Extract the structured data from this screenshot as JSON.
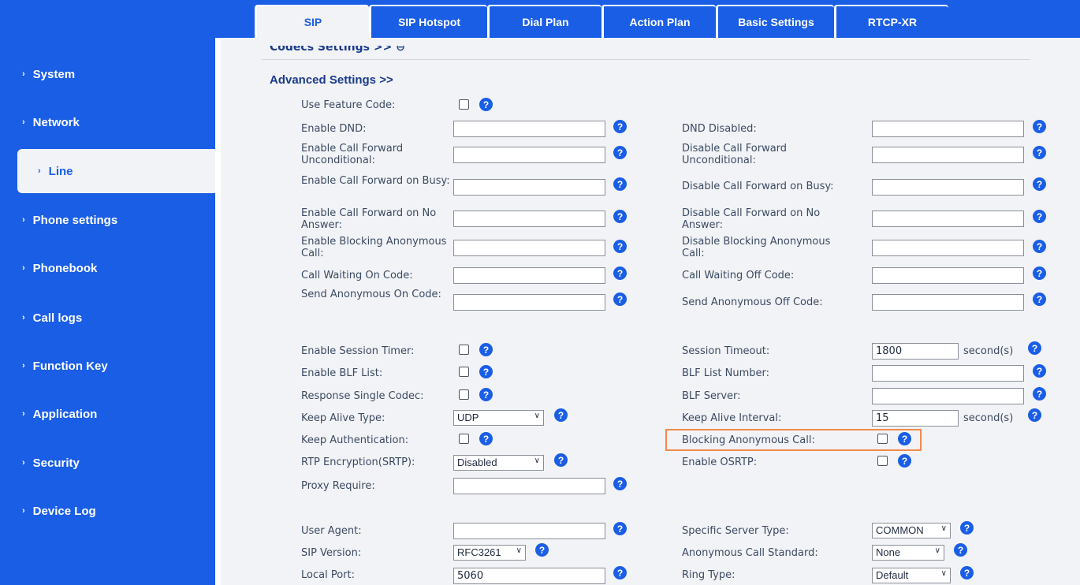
{
  "tabs": [
    "SIP",
    "SIP Hotspot",
    "Dial Plan",
    "Action Plan",
    "Basic Settings",
    "RTCP-XR"
  ],
  "sidebar": [
    "System",
    "Network",
    "Line",
    "Phone settings",
    "Phonebook",
    "Call logs",
    "Function Key",
    "Application",
    "Security",
    "Device Log"
  ],
  "nav_chevron": "›",
  "codecs_cut": "Codecs Settings >> ⊖",
  "advanced_title": "Advanced Settings >>",
  "help_glyph": "?",
  "select_arrow": "∨",
  "fields": {
    "use_feature_code": "Use Feature Code:",
    "enable_dnd": "Enable DND:",
    "dnd_disabled": "DND Disabled:",
    "ecf_uncond": "Enable Call Forward Unconditional:",
    "dcf_uncond": "Disable Call Forward Unconditional:",
    "ecf_busy": "Enable Call Forward on Busy:",
    "dcf_busy": "Disable Call Forward on Busy:",
    "ecf_noans": "Enable Call Forward on No Answer:",
    "dcf_noans": "Disable Call Forward on No Answer:",
    "enable_block": "Enable Blocking Anonymous Call:",
    "disable_block": "Disable Blocking Anonymous Call:",
    "cw_on": "Call Waiting On Code:",
    "cw_off": "Call Waiting Off Code:",
    "send_anon_on": "Send Anonymous On Code:",
    "send_anon_off": "Send Anonymous Off Code:",
    "session_timer": "Enable Session Timer:",
    "session_timeout": "Session Timeout:",
    "session_timeout_value": "1800",
    "seconds": "second(s)",
    "blf_list": "Enable BLF List:",
    "blf_list_number": "BLF List Number:",
    "resp_single_codec": "Response Single Codec:",
    "blf_server": "BLF Server:",
    "keep_alive_type": "Keep Alive Type:",
    "keep_alive_type_value": "UDP",
    "keep_alive_interval": "Keep Alive Interval:",
    "keep_alive_interval_value": "15",
    "keep_auth": "Keep Authentication:",
    "blocking_anon": "Blocking Anonymous Call:",
    "rtp_enc": "RTP Encryption(SRTP):",
    "rtp_enc_value": "Disabled",
    "enable_osrtp": "Enable OSRTP:",
    "proxy_require": "Proxy Require:",
    "user_agent": "User Agent:",
    "specific_server": "Specific Server Type:",
    "specific_server_value": "COMMON",
    "sip_version": "SIP Version:",
    "sip_version_value": "RFC3261",
    "anon_standard": "Anonymous Call Standard:",
    "anon_standard_value": "None",
    "local_port": "Local Port:",
    "local_port_value": "5060",
    "ring_type": "Ring Type:",
    "ring_type_value": "Default"
  },
  "colors": {
    "brand_blue": "#1a5ee6",
    "highlight": "#f08a4b",
    "content_bg": "#f2f3f6"
  }
}
